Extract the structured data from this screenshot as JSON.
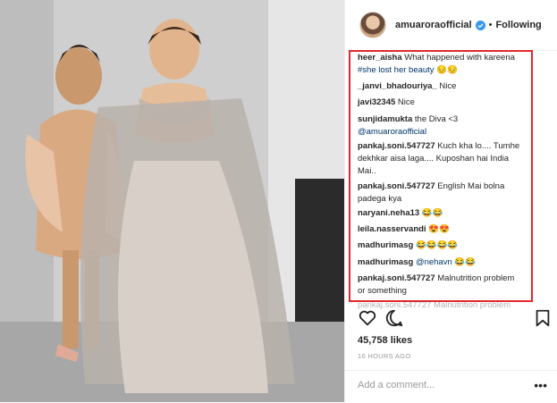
{
  "post": {
    "username": "amuaroraofficial",
    "follow_status": "Following",
    "likes": "45,758 likes",
    "time_ago": "16 HOURS AGO",
    "add_comment_placeholder": "Add a comment...",
    "more_glyph": "•••"
  },
  "comments": [
    {
      "user": "heer_aisha",
      "text": "What happened with kareena",
      "line2": "#she lost her beauty 😔😔"
    },
    {
      "user": "_janvi_bhadouriya_",
      "text": "Nice"
    },
    {
      "user": "javi32345",
      "text": "Nice"
    },
    {
      "user": "sunjidamukta",
      "text": "the Diva <3",
      "mention": "@amuaroraofficial"
    },
    {
      "user": "pankaj.soni.547727",
      "text": "Kuch kha lo.... Tumhe",
      "line2": "dekhkar aisa laga.... Kuposhan hai India",
      "line3": "Mai.."
    },
    {
      "user": "pankaj.soni.547727",
      "text": "English Mai bolna",
      "line2": "padega kya"
    },
    {
      "user": "naryani.neha13",
      "text": "😂😂"
    },
    {
      "user": "leila.nasservandi",
      "text": "😍😍"
    },
    {
      "user": "madhurimasg",
      "text": "😂😂😂😂"
    },
    {
      "user": "madhurimasg",
      "text": "😂😂",
      "mention": "@nehavn"
    },
    {
      "user": "pankaj.soni.547727",
      "text": "Malnutrition problem",
      "line2": "or something"
    }
  ],
  "peek_text": "pankaj.soni.547727 Malnutrition problem",
  "colors": {
    "highlight_box": "#e3282d",
    "verified": "#3897f0",
    "mention": "#003569"
  },
  "icons": [
    "verified-badge-icon",
    "heart-icon",
    "comment-icon",
    "bookmark-icon",
    "more-icon"
  ]
}
